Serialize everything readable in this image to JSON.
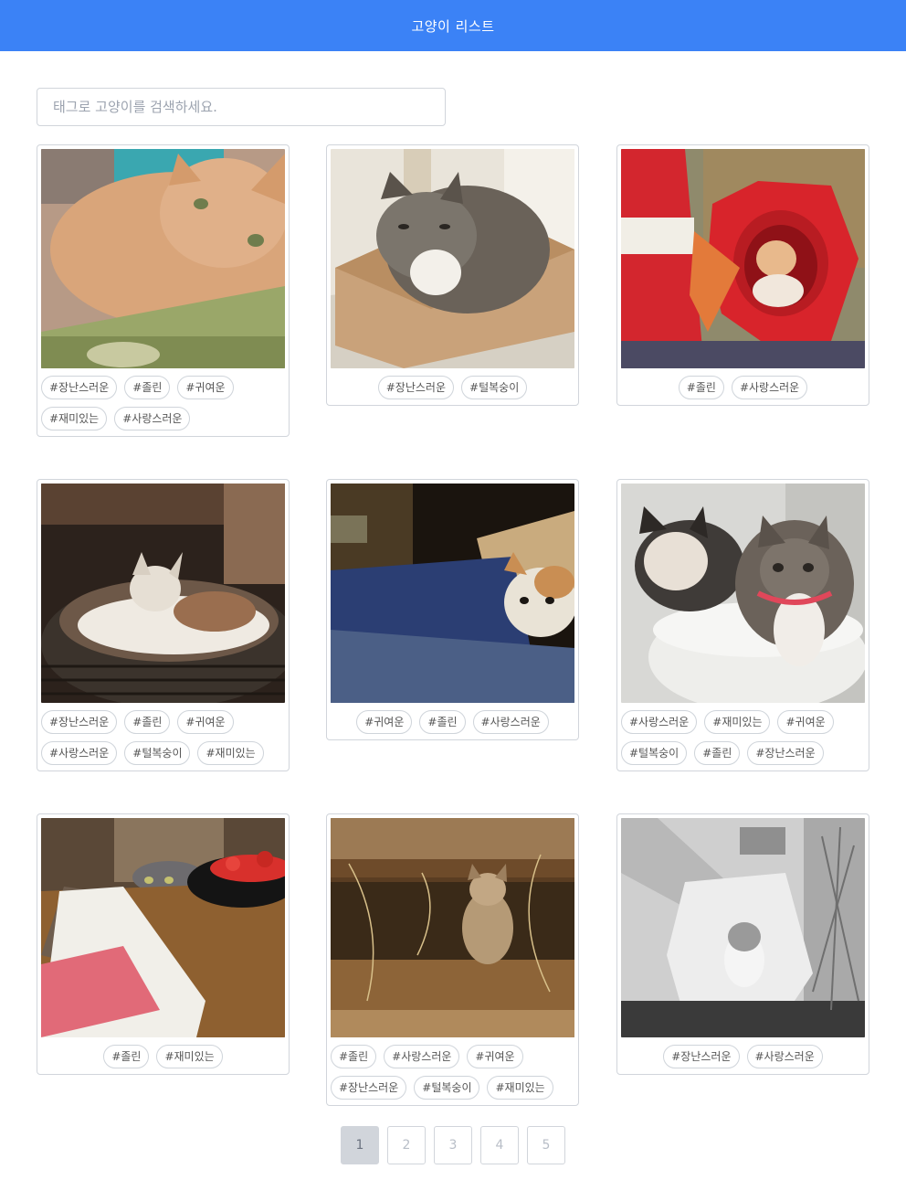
{
  "header": {
    "title": "고양이 리스트"
  },
  "search": {
    "placeholder": "태그로 고양이를 검색하세요."
  },
  "cards": [
    {
      "tags": [
        "#장난스러운",
        "#졸린",
        "#귀여운",
        "#재미있는",
        "#사랑스러운"
      ]
    },
    {
      "tags": [
        "#장난스러운",
        "#털복숭이"
      ]
    },
    {
      "tags": [
        "#졸린",
        "#사랑스러운"
      ]
    },
    {
      "tags": [
        "#장난스러운",
        "#졸린",
        "#귀여운",
        "#사랑스러운",
        "#털복숭이",
        "#재미있는"
      ]
    },
    {
      "tags": [
        "#귀여운",
        "#졸린",
        "#사랑스러운"
      ]
    },
    {
      "tags": [
        "#사랑스러운",
        "#재미있는",
        "#귀여운",
        "#털복숭이",
        "#졸린",
        "#장난스러운"
      ]
    },
    {
      "tags": [
        "#졸린",
        "#재미있는"
      ]
    },
    {
      "tags": [
        "#졸린",
        "#사랑스러운",
        "#귀여운",
        "#장난스러운",
        "#털복숭이",
        "#재미있는"
      ]
    },
    {
      "tags": [
        "#장난스러운",
        "#사랑스러운"
      ]
    }
  ],
  "pagination": {
    "pages": [
      "1",
      "2",
      "3",
      "4",
      "5"
    ],
    "current": "1"
  },
  "colors": {
    "accent": "#3b82f6",
    "border": "#d1d5db"
  }
}
